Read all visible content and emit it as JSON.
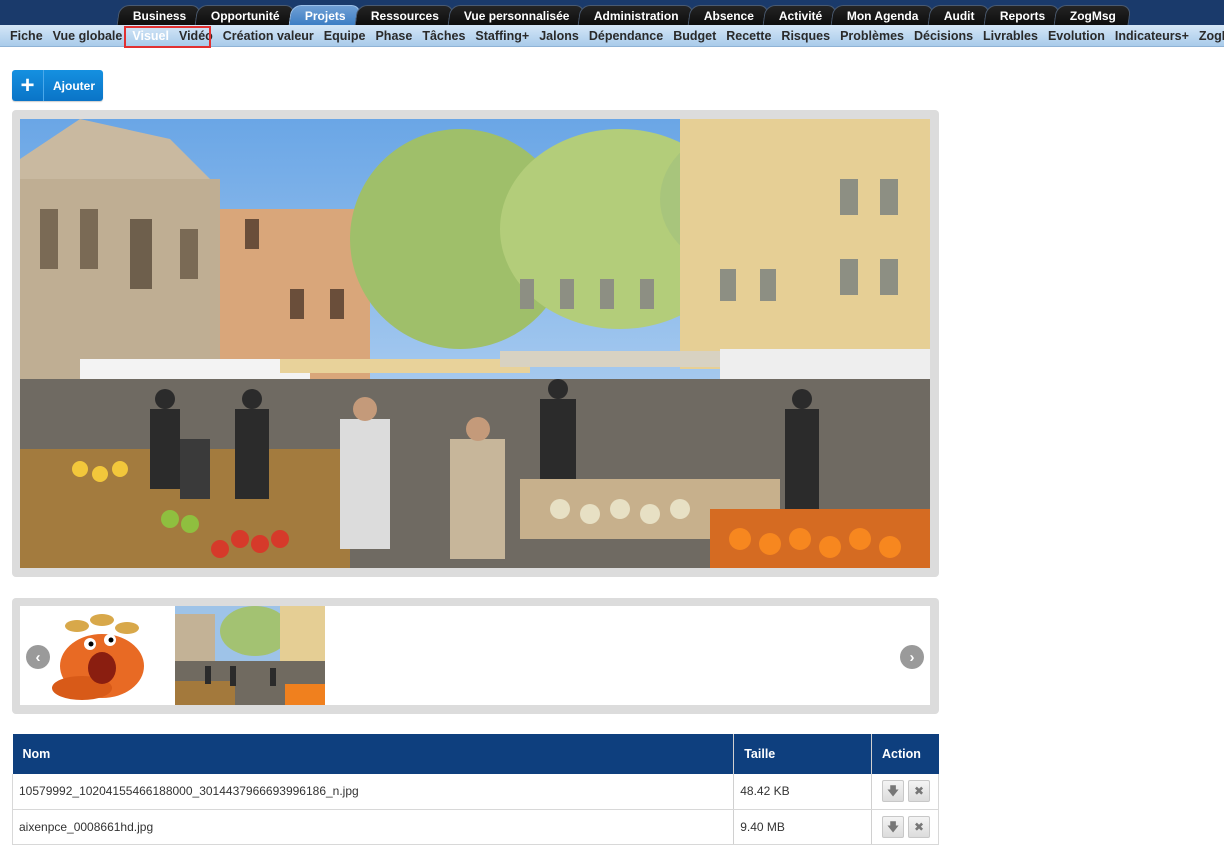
{
  "top_tabs": [
    {
      "label": "Business"
    },
    {
      "label": "Opportunité"
    },
    {
      "label": "Projets",
      "active": true
    },
    {
      "label": "Ressources"
    },
    {
      "label": "Vue personnalisée"
    },
    {
      "label": "Administration"
    },
    {
      "label": "Absence"
    },
    {
      "label": "Activité"
    },
    {
      "label": "Mon Agenda"
    },
    {
      "label": "Audit"
    },
    {
      "label": "Reports"
    },
    {
      "label": "ZogMsg"
    }
  ],
  "sub_nav": [
    {
      "label": "Fiche"
    },
    {
      "label": "Vue globale"
    },
    {
      "label": "Visuel",
      "active": true
    },
    {
      "label": "Vidéo"
    },
    {
      "label": "Création valeur"
    },
    {
      "label": "Equipe"
    },
    {
      "label": "Phase"
    },
    {
      "label": "Tâches"
    },
    {
      "label": "Staffing+"
    },
    {
      "label": "Jalons"
    },
    {
      "label": "Dépendance"
    },
    {
      "label": "Budget"
    },
    {
      "label": "Recette"
    },
    {
      "label": "Risques"
    },
    {
      "label": "Problèmes"
    },
    {
      "label": "Décisions"
    },
    {
      "label": "Livrables"
    },
    {
      "label": "Evolution"
    },
    {
      "label": "Indicateurs+"
    },
    {
      "label": "ZogMsg"
    }
  ],
  "toolbar": {
    "add_label": "Ajouter"
  },
  "carousel": {
    "prev_icon": "chevron-left-icon",
    "next_icon": "chevron-right-icon"
  },
  "file_table": {
    "headers": {
      "name": "Nom",
      "size": "Taille",
      "action": "Action"
    },
    "rows": [
      {
        "name": "10579992_10204155466188000_3014437966693996186_n.jpg",
        "size": "48.42 KB"
      },
      {
        "name": "aixenpce_0008661hd.jpg",
        "size": "9.40 MB"
      }
    ]
  },
  "colors": {
    "topbar": "#1a3a6b",
    "table_header": "#0e3f7e",
    "add_button": "#0a74c7",
    "selection_outline": "#e13030"
  }
}
